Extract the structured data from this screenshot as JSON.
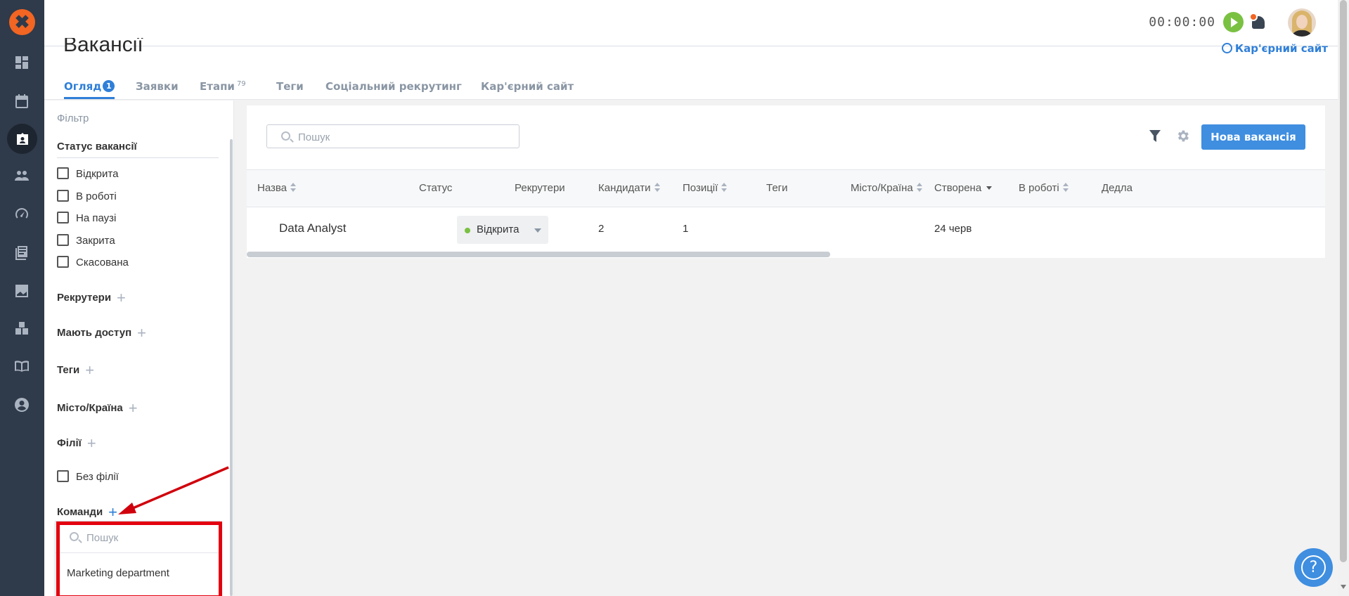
{
  "nav": {
    "logo": "✖",
    "icons": [
      "dashboard-icon",
      "calendar-icon",
      "vacancies-icon",
      "people-icon",
      "speedometer-icon",
      "library-icon",
      "chart-icon",
      "boxes-icon",
      "book-icon",
      "account-icon"
    ],
    "active": "vacancies-icon"
  },
  "topbar": {
    "timer": "00:00:00"
  },
  "page": {
    "title": "Вакансії",
    "career_link": "Кар'єрний сайт",
    "tabs": [
      {
        "label": "Огляд",
        "badge": "1"
      },
      {
        "label": "Заявки"
      },
      {
        "label": "Етапи",
        "sup": "79"
      },
      {
        "label": "Теги"
      },
      {
        "label": "Соціальний рекрутинг"
      },
      {
        "label": "Кар'єрний сайт"
      }
    ]
  },
  "filter": {
    "title": "Фільтр",
    "status_section": "Статус вакансії",
    "statuses": [
      "Відкрита",
      "В роботі",
      "На паузі",
      "Закрита",
      "Скасована"
    ],
    "recruiters": "Рекрутери",
    "access": "Мають доступ",
    "tags": "Теги",
    "city": "Місто/Країна",
    "branches": "Філії",
    "no_branch": "Без філії",
    "teams": "Команди",
    "teams_search_placeholder": "Пошук",
    "teams_options": [
      "Marketing department"
    ]
  },
  "main": {
    "search_placeholder": "Пошук",
    "new_button": "Нова вакансія",
    "columns": [
      "Назва",
      "Статус",
      "Рекрутери",
      "Кандидати",
      "Позиції",
      "Теги",
      "Місто/Країна",
      "Створена",
      "В роботі",
      "Дедла"
    ],
    "rows": [
      {
        "name": "Data Analyst",
        "status": "Відкрита",
        "recruiters": "",
        "candidates": "2",
        "positions": "1",
        "tags": "",
        "city": "",
        "created": "24 черв",
        "in_work": ""
      }
    ],
    "status_color": "#7ac142"
  },
  "help": "?"
}
